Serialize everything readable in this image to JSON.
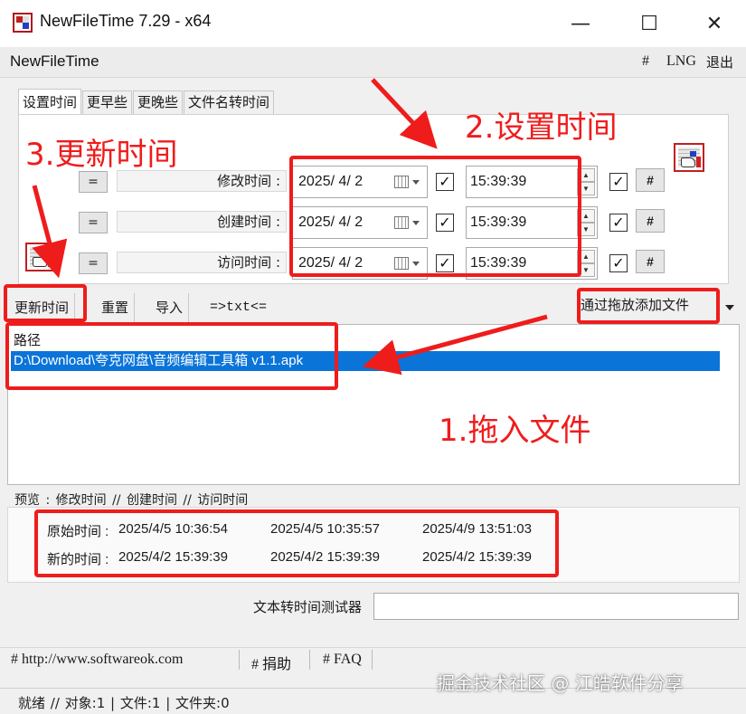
{
  "window": {
    "title": "NewFileTime 7.29 - x64",
    "min_glyph": "—",
    "max_glyph": "☐",
    "close_glyph": "✕"
  },
  "menubar": {
    "app_name": "NewFileTime",
    "hash": "#",
    "lng": "LNG",
    "exit": "退出"
  },
  "tabs": [
    {
      "label": "设置时间",
      "active": true
    },
    {
      "label": "更早些",
      "active": false
    },
    {
      "label": "更晚些",
      "active": false
    },
    {
      "label": "文件名转时间",
      "active": false
    }
  ],
  "time_rows": [
    {
      "eq": "=",
      "label": "修改时间 :",
      "date": "2025/  4/  2",
      "checked": "✓",
      "time": "15:39:39",
      "time_checked": "✓",
      "hash": "#"
    },
    {
      "eq": "=",
      "label": "创建时间 :",
      "date": "2025/  4/  2",
      "checked": "✓",
      "time": "15:39:39",
      "time_checked": "✓",
      "hash": "#"
    },
    {
      "eq": "=",
      "label": "访问时间 :",
      "date": "2025/  4/  2",
      "checked": "✓",
      "time": "15:39:39",
      "time_checked": "✓",
      "hash": "#"
    }
  ],
  "toolbar": {
    "update": "更新时间",
    "reset": "重置",
    "import": "导入",
    "txt": "=>txt<=",
    "dropdown": "通过拖放添加文件"
  },
  "filelist": {
    "column_header": "路径",
    "rows": [
      "D:\\Download\\夸克网盘\\音频编辑工具箱 v1.1.apk"
    ]
  },
  "preview": {
    "title": "预览 :   修改时间   //   创建时间   //   访问时间",
    "original_label": "原始时间 :",
    "original": [
      "2025/4/5 10:36:54",
      "2025/4/5 10:35:57",
      "2025/4/9 13:51:03"
    ],
    "new_label": "新的时间 :",
    "new": [
      "2025/4/2 15:39:39",
      "2025/4/2 15:39:39",
      "2025/4/2 15:39:39"
    ]
  },
  "tester": {
    "label": "文本转时间测试器",
    "value": ""
  },
  "links": {
    "website": "# http://www.softwareok.com",
    "donate": "# 捐助",
    "faq": "# FAQ"
  },
  "status": {
    "text": "就绪 // 对象:1  |  文件:1  |  文件夹:0"
  },
  "watermark": "掘金技术社区 @ 江皓软件分享",
  "annotations": {
    "step1": "1.拖入文件",
    "step2": "2.设置时间",
    "step3": "3.更新时间",
    "color": "#ef1c1c"
  }
}
